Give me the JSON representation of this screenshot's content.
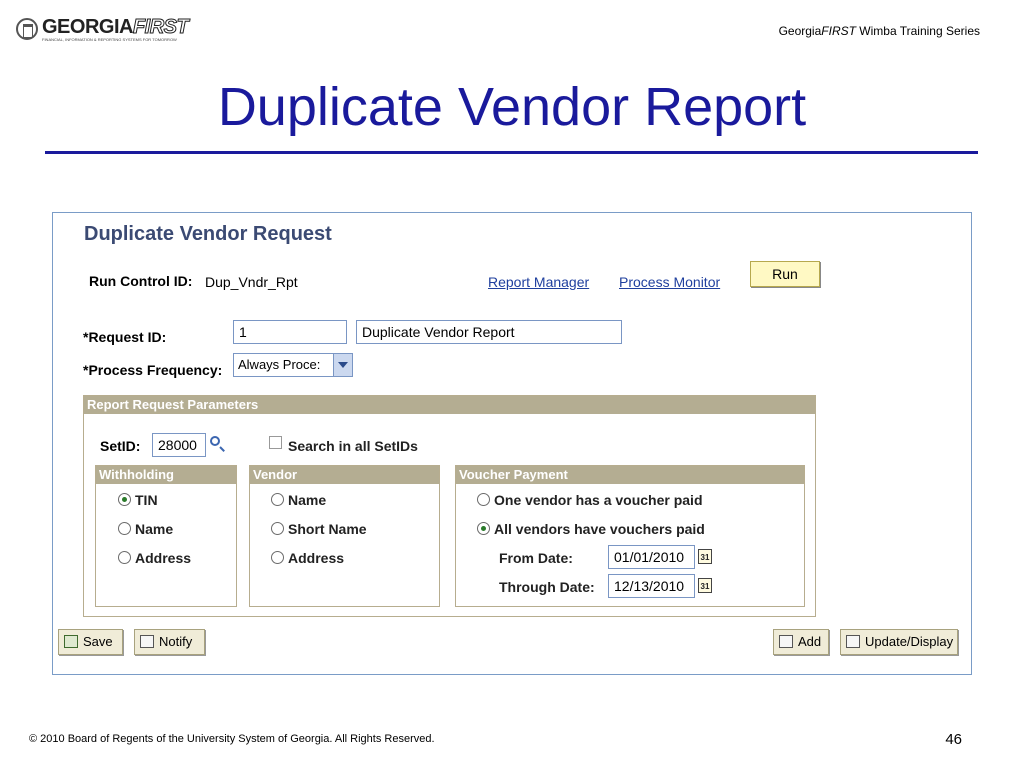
{
  "header": {
    "logo_text": "GEORGIA",
    "logo_text_italic": "FIRST",
    "logo_subtitle": "FINANCIAL, INFORMATION & REPORTING SYSTEMS FOR TOMORROW",
    "series_prefix": "Georgia",
    "series_italic": "FIRST",
    "series_suffix": " Wimba Training Series"
  },
  "slide_title": "Duplicate Vendor Report",
  "page": {
    "title": "Duplicate Vendor Request",
    "run_control_label": "Run Control ID:",
    "run_control_value": "Dup_Vndr_Rpt",
    "report_manager_link": "Report Manager",
    "process_monitor_link": "Process Monitor",
    "run_button": "Run",
    "request_id_label": "*Request ID:",
    "request_id_value": "1",
    "request_desc_value": "Duplicate Vendor Report",
    "process_freq_label": "*Process Frequency:",
    "process_freq_value": "Always Proce:"
  },
  "params": {
    "header": "Report Request Parameters",
    "setid_label": "SetID:",
    "setid_value": "28000",
    "search_all_label": "Search in all SetIDs",
    "withholding": {
      "header": "Withholding",
      "options": [
        {
          "label": "TIN",
          "selected": true
        },
        {
          "label": "Name",
          "selected": false
        },
        {
          "label": "Address",
          "selected": false
        }
      ]
    },
    "vendor": {
      "header": "Vendor",
      "options": [
        {
          "label": "Name",
          "selected": false
        },
        {
          "label": "Short Name",
          "selected": false
        },
        {
          "label": "Address",
          "selected": false
        }
      ]
    },
    "voucher": {
      "header": "Voucher Payment",
      "options": [
        {
          "label": "One vendor has a voucher paid",
          "selected": false
        },
        {
          "label": "All vendors have vouchers paid",
          "selected": true
        }
      ],
      "from_label": "From Date:",
      "from_value": "01/01/2010",
      "through_label": "Through Date:",
      "through_value": "12/13/2010",
      "cal_text": "31"
    }
  },
  "toolbar": {
    "save": "Save",
    "notify": "Notify",
    "add": "Add",
    "update": "Update/Display"
  },
  "footer": {
    "copyright": "© 2010 Board of Regents of the University System of Georgia.  All Rights Reserved.",
    "page_number": "46"
  }
}
